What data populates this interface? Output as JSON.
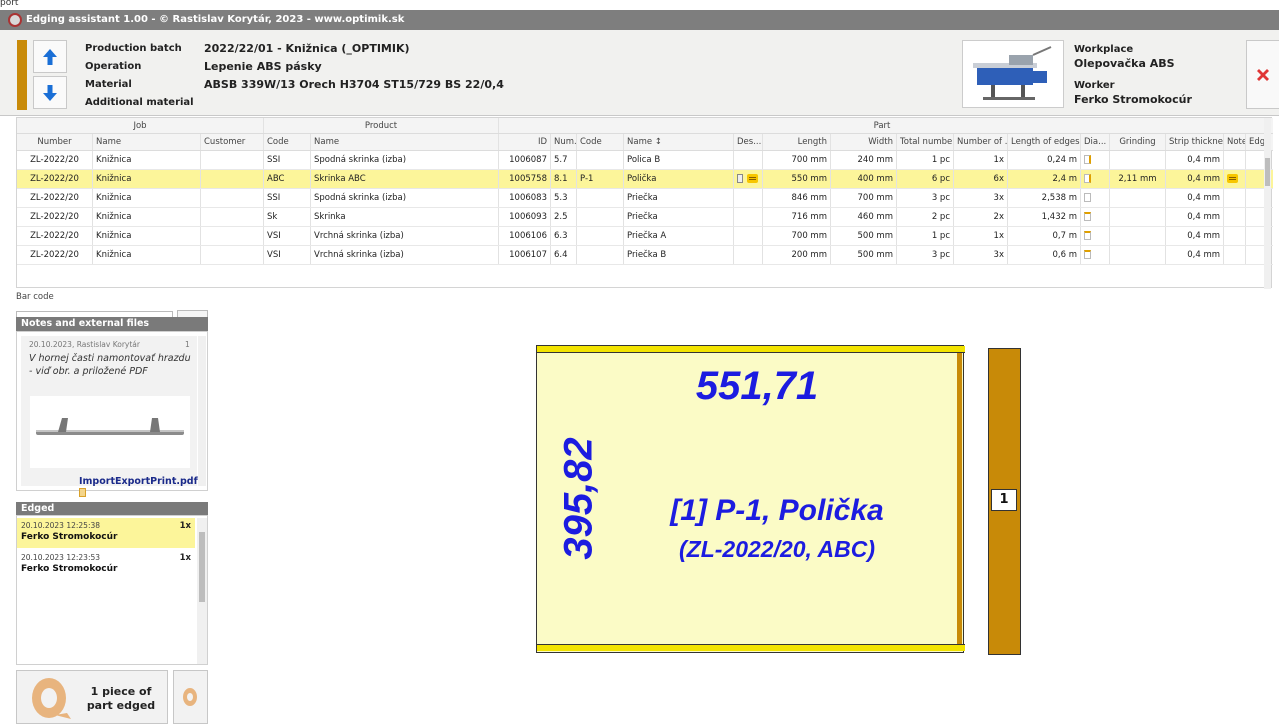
{
  "window": {
    "pretitle": "port",
    "title": "Edging assistant 1.00 - © Rastislav Korytár, 2023 - www.optimik.sk"
  },
  "header": {
    "labels": {
      "batch": "Production batch",
      "operation": "Operation",
      "material": "Material",
      "additional": "Additional material"
    },
    "values": {
      "batch": "2022/22/01 - Knižnica (_OPTIMIK)",
      "operation": "Lepenie ABS pásky",
      "material": "ABSB 339W/13 Orech H3704 ST15/729 BS 22/0,4",
      "additional": ""
    },
    "workplace_label": "Workplace",
    "workplace": "Olepovačka ABS",
    "worker_label": "Worker",
    "worker": "Ferko Stromokocúr"
  },
  "grid": {
    "groups": [
      "Job",
      "Product",
      "Part"
    ],
    "columns": [
      "Number",
      "Name",
      "Customer",
      "Code",
      "Name",
      "ID",
      "Num...",
      "Code",
      "Name ↕",
      "Des...",
      "Length",
      "Width",
      "Total number",
      "Number of ...",
      "Length of edges",
      "Dia...",
      "Grinding",
      "Strip thickne...",
      "Note",
      "Edg..."
    ],
    "rows": [
      {
        "number": "ZL-2022/20",
        "name": "Knižnica",
        "customer": "",
        "code": "SSI",
        "product": "Spodná skrinka (izba)",
        "id": "1006087",
        "num": "5.7",
        "pcode": "",
        "pname": "Polica B",
        "length": "700 mm",
        "width": "240 mm",
        "total": "1 pc",
        "count": "1x",
        "edges": "0,24 m",
        "grinding": "",
        "strip": "0,4 mm",
        "note": false,
        "attach": false,
        "edge_icon": "right"
      },
      {
        "number": "ZL-2022/20",
        "name": "Knižnica",
        "customer": "",
        "code": "ABC",
        "product": "Skrinka ABC",
        "id": "1005758",
        "num": "8.1",
        "pcode": "P-1",
        "pname": "Polička",
        "length": "550 mm",
        "width": "400 mm",
        "total": "6 pc",
        "count": "6x",
        "edges": "2,4 m",
        "grinding": "2,11 mm",
        "strip": "0,4 mm",
        "note": true,
        "attach": true,
        "edge_icon": "right"
      },
      {
        "number": "ZL-2022/20",
        "name": "Knižnica",
        "customer": "",
        "code": "SSI",
        "product": "Spodná skrinka (izba)",
        "id": "1006083",
        "num": "5.3",
        "pcode": "",
        "pname": "Priečka",
        "length": "846 mm",
        "width": "700 mm",
        "total": "3 pc",
        "count": "3x",
        "edges": "2,538 m",
        "grinding": "",
        "strip": "0,4 mm",
        "note": false,
        "attach": false,
        "edge_icon": "none"
      },
      {
        "number": "ZL-2022/20",
        "name": "Knižnica",
        "customer": "",
        "code": "Sk",
        "product": "Skrinka",
        "id": "1006093",
        "num": "2.5",
        "pcode": "",
        "pname": "Priečka",
        "length": "716 mm",
        "width": "460 mm",
        "total": "2 pc",
        "count": "2x",
        "edges": "1,432 m",
        "grinding": "",
        "strip": "0,4 mm",
        "note": false,
        "attach": false,
        "edge_icon": "top"
      },
      {
        "number": "ZL-2022/20",
        "name": "Knižnica",
        "customer": "",
        "code": "VSI",
        "product": "Vrchná skrinka (izba)",
        "id": "1006106",
        "num": "6.3",
        "pcode": "",
        "pname": "Priečka A",
        "length": "700 mm",
        "width": "500 mm",
        "total": "1 pc",
        "count": "1x",
        "edges": "0,7 m",
        "grinding": "",
        "strip": "0,4 mm",
        "note": false,
        "attach": false,
        "edge_icon": "top"
      },
      {
        "number": "ZL-2022/20",
        "name": "Knižnica",
        "customer": "",
        "code": "VSI",
        "product": "Vrchná skrinka (izba)",
        "id": "1006107",
        "num": "6.4",
        "pcode": "",
        "pname": "Priečka B",
        "length": "200 mm",
        "width": "500 mm",
        "total": "3 pc",
        "count": "3x",
        "edges": "0,6 m",
        "grinding": "",
        "strip": "0,4 mm",
        "note": false,
        "attach": false,
        "edge_icon": "top"
      }
    ]
  },
  "barcode": {
    "label": "Bar code",
    "value": ""
  },
  "notes": {
    "title": "Notes and external files",
    "meta": "20.10.2023, Rastislav Korytár",
    "index": "1",
    "text": "V hornej časti namontovať hrazdu - viď obr. a priložené PDF",
    "file": "ImportExportPrint.pdf"
  },
  "edged": {
    "title": "Edged",
    "items": [
      {
        "date": "20.10.2023 12:25:38",
        "count": "1x",
        "worker": "Ferko Stromokocúr"
      },
      {
        "date": "20.10.2023 12:23:53",
        "count": "1x",
        "worker": "Ferko Stromokocúr"
      }
    ]
  },
  "action": {
    "label": "1 piece of part edged"
  },
  "part_view": {
    "length": "551,71",
    "width": "395,82",
    "name": "[1]  P-1, Polička",
    "ref": "(ZL-2022/20, ABC)",
    "strip_number": "1"
  },
  "colors": {
    "accent": "#c88a08",
    "selected_row": "#fcf59a",
    "part_text": "#1c1ce0",
    "edge_yellow": "#f2e300"
  }
}
